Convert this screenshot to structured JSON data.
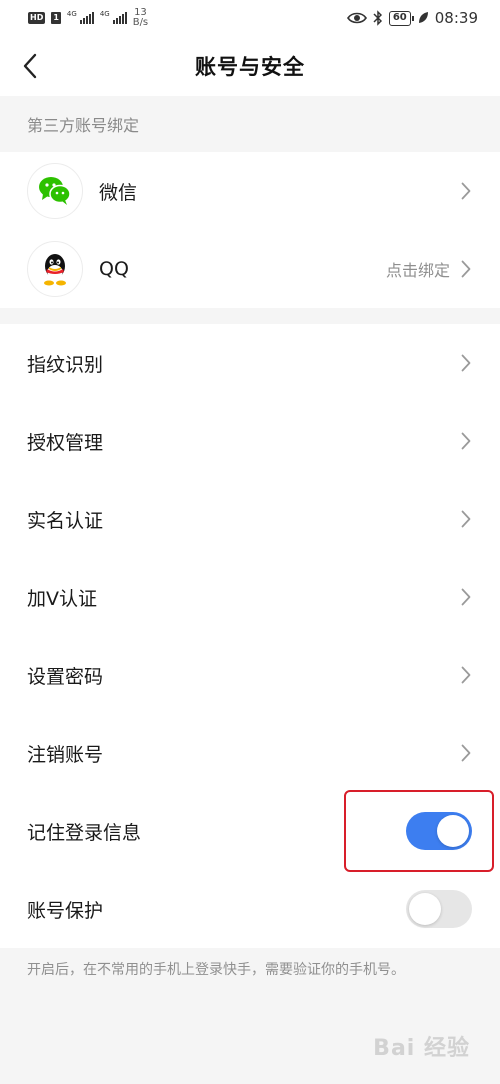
{
  "status_bar": {
    "hd_label": "HD",
    "sim_label": "1",
    "net1": "4G",
    "net2": "4G",
    "speed_value": "13",
    "speed_unit": "B/s",
    "battery": "60",
    "time": "08:39"
  },
  "nav": {
    "title": "账号与安全"
  },
  "third_party": {
    "header": "第三方账号绑定",
    "items": [
      {
        "label": "微信",
        "value": "",
        "icon": "wechat-icon"
      },
      {
        "label": "QQ",
        "value": "点击绑定",
        "icon": "qq-icon"
      }
    ]
  },
  "settings": {
    "items": [
      {
        "label": "指纹识别"
      },
      {
        "label": "授权管理"
      },
      {
        "label": "实名认证"
      },
      {
        "label": "加V认证"
      },
      {
        "label": "设置密码"
      },
      {
        "label": "注销账号"
      }
    ],
    "toggles": [
      {
        "label": "记住登录信息",
        "on": true
      },
      {
        "label": "账号保护",
        "on": false
      }
    ]
  },
  "footnote": "开启后，在不常用的手机上登录快手，需要验证你的手机号。",
  "watermark": "Bai 经验",
  "colors": {
    "accent": "#3d7ef0",
    "highlight": "#d81e2a",
    "wechat": "#2dc100"
  }
}
